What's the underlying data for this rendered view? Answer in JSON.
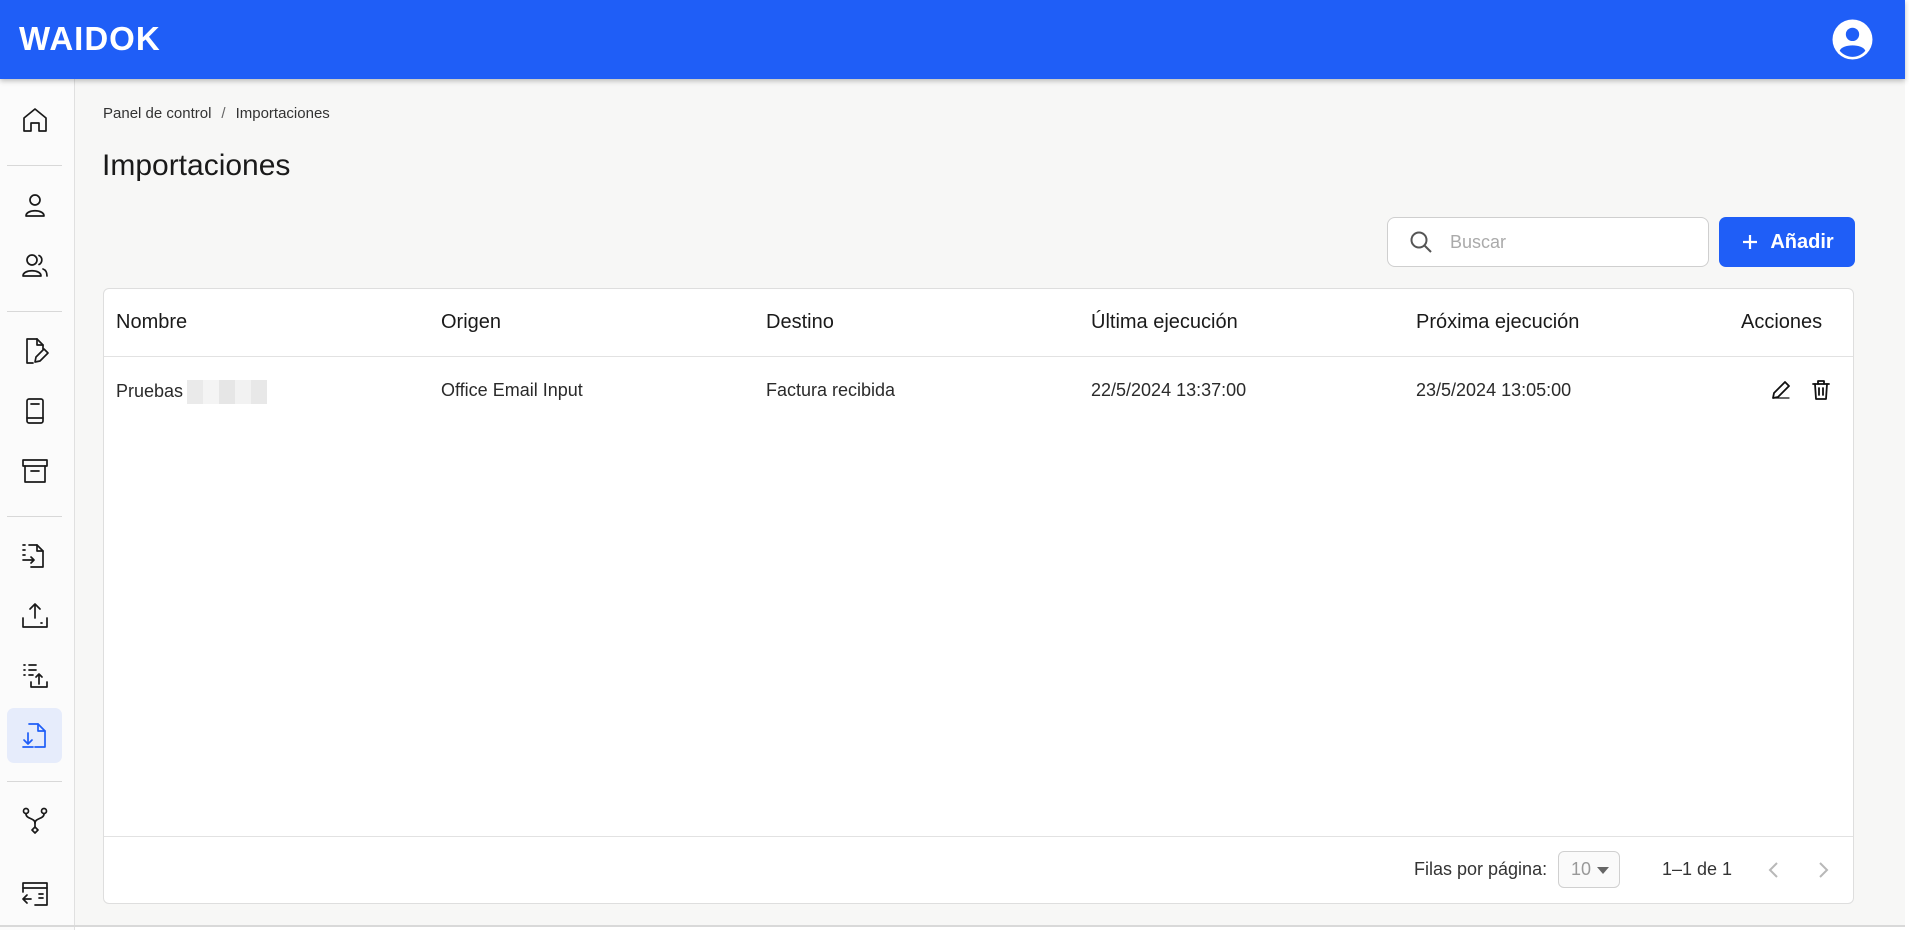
{
  "app": {
    "logo": "WAIDOK"
  },
  "header": {
    "avatar": "account-circle-icon"
  },
  "sidebar": {
    "items": [
      {
        "name": "home-icon"
      },
      {
        "name": "user-icon"
      },
      {
        "name": "users-icon"
      },
      {
        "name": "document-edit-icon"
      },
      {
        "name": "book-icon"
      },
      {
        "name": "archive-icon"
      },
      {
        "name": "file-transfer-icon"
      },
      {
        "name": "upload-tray-icon"
      },
      {
        "name": "list-upload-icon"
      },
      {
        "name": "file-download-icon",
        "active": true
      },
      {
        "name": "workflow-icon"
      },
      {
        "name": "window-exit-icon"
      }
    ]
  },
  "breadcrumb": {
    "root": "Panel de control",
    "separator": "/",
    "current": "Importaciones"
  },
  "page": {
    "title": "Importaciones"
  },
  "search": {
    "placeholder": "Buscar"
  },
  "toolbar": {
    "add_label": "Añadir"
  },
  "table": {
    "columns": {
      "nombre": "Nombre",
      "origen": "Origen",
      "destino": "Destino",
      "ultima": "Última ejecución",
      "proxima": "Próxima ejecución",
      "acciones": "Acciones"
    },
    "rows": [
      {
        "nombre": "Pruebas",
        "origen": "Office Email Input",
        "destino": "Factura recibida",
        "ultima": "22/5/2024 13:37:00",
        "proxima": "23/5/2024 13:05:00"
      }
    ]
  },
  "pagination": {
    "rows_per_page_label": "Filas por página:",
    "rows_per_page": "10",
    "range": "1–1 de 1"
  },
  "colors": {
    "primary": "#1f5ef7",
    "background": "#f7f7f6"
  }
}
